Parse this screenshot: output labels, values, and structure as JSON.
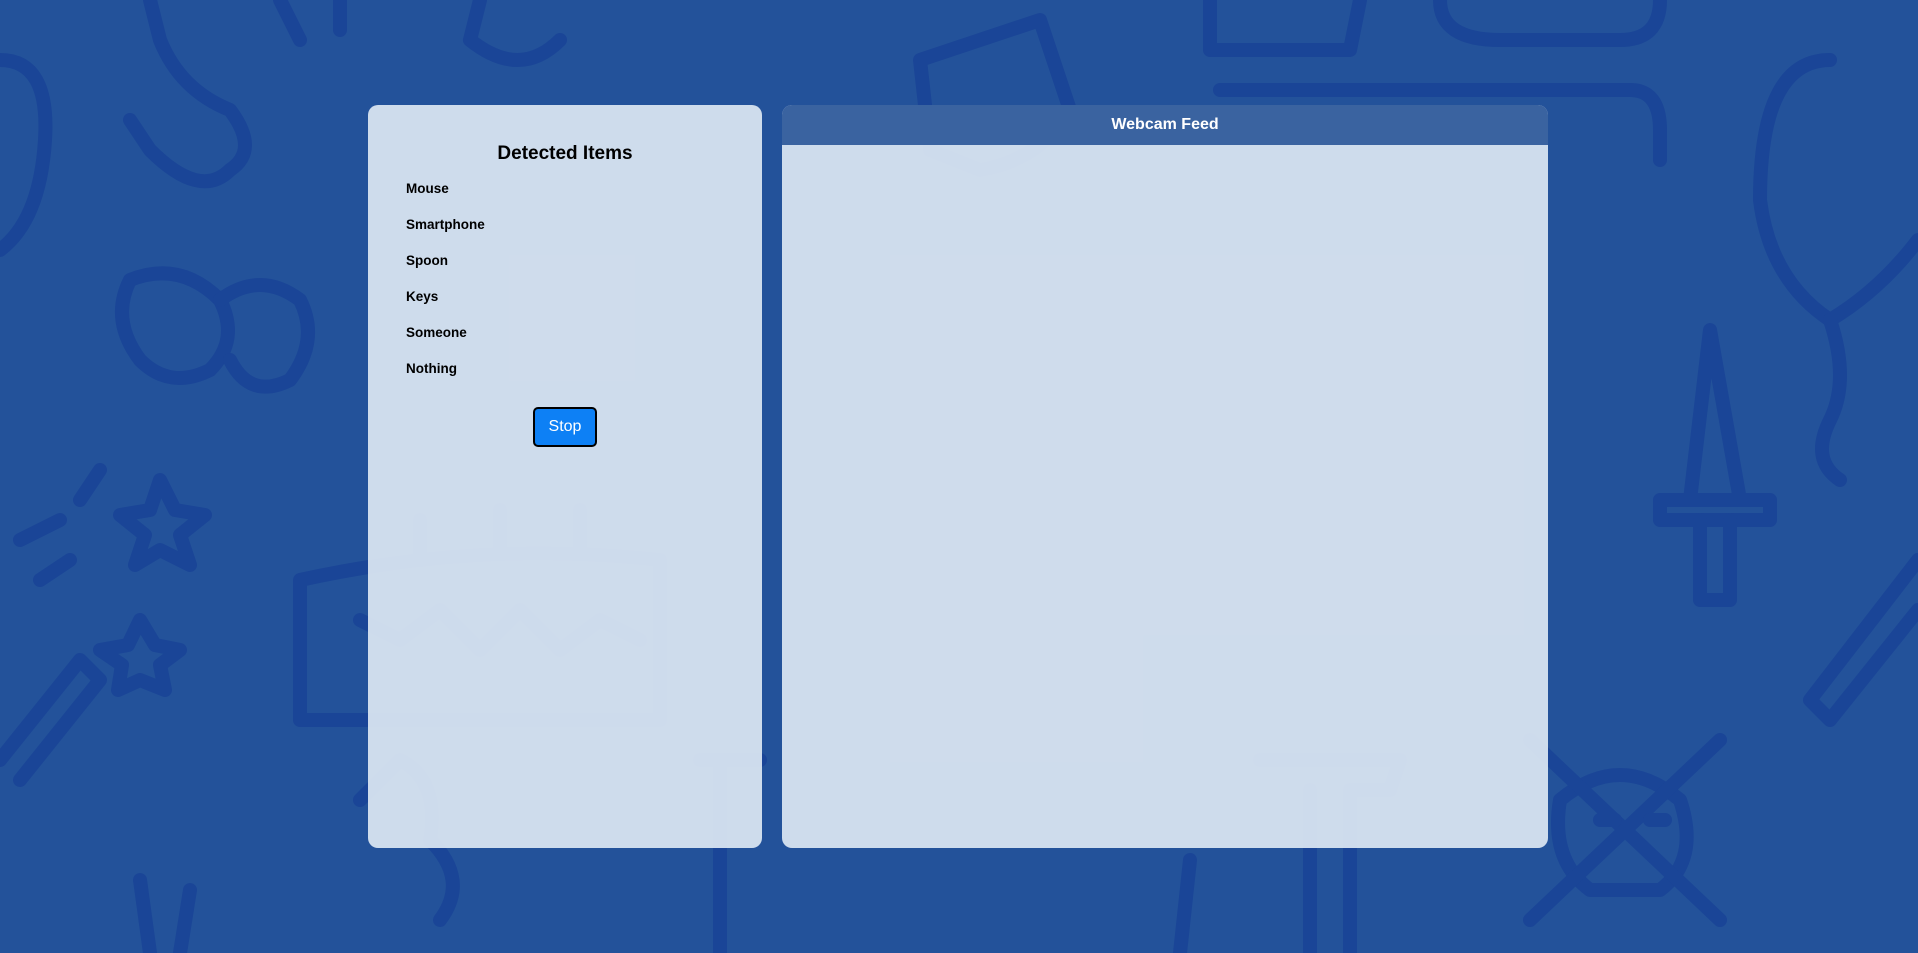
{
  "sidebar": {
    "title": "Detected Items",
    "items": [
      {
        "label": "Mouse"
      },
      {
        "label": "Smartphone"
      },
      {
        "label": "Spoon"
      },
      {
        "label": "Keys"
      },
      {
        "label": "Someone"
      },
      {
        "label": "Nothing"
      }
    ],
    "stop_label": "Stop"
  },
  "feed": {
    "header": "Webcam Feed"
  },
  "colors": {
    "background": "#23529a",
    "doodle": "#1a4597",
    "panel": "#dce6f2",
    "feed_header": "#3a63a0",
    "stop_button": "#0d80f5"
  }
}
